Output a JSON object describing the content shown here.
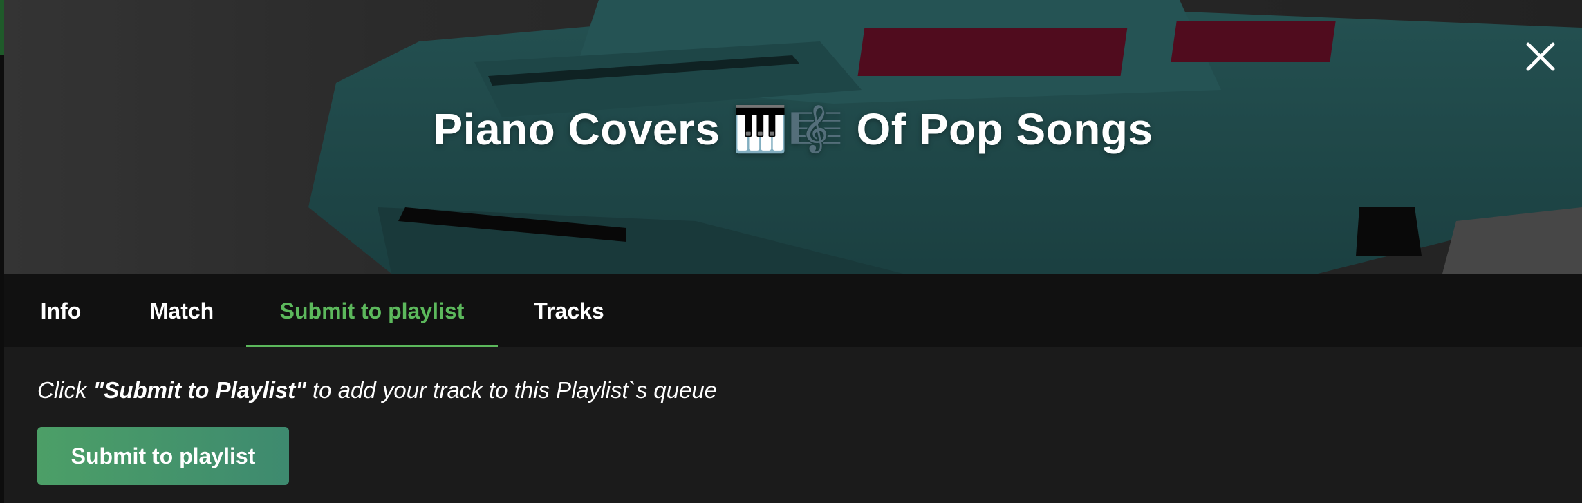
{
  "playlist": {
    "title": "Piano Covers 🎹🎼 Of Pop Songs"
  },
  "icons": {
    "close": "close-icon"
  },
  "tabs": [
    {
      "label": "Info",
      "active": false
    },
    {
      "label": "Match",
      "active": false
    },
    {
      "label": "Submit to playlist",
      "active": true
    },
    {
      "label": "Tracks",
      "active": false
    }
  ],
  "submit_panel": {
    "instruction_prefix": "Click ",
    "instruction_emphasis": "\"Submit to Playlist\"",
    "instruction_suffix": " to add your track to this Playlist`s queue",
    "button_label": "Submit to playlist"
  },
  "colors": {
    "accent": "#5cb85c",
    "button_start": "#4c9f67",
    "button_end": "#3e8a6f",
    "background": "#1b1b1b",
    "tabbar": "#111111"
  }
}
